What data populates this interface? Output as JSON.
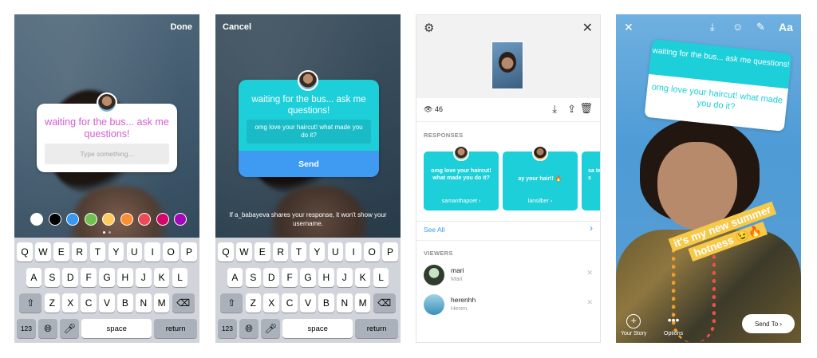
{
  "screen1": {
    "done_label": "Done",
    "question": "waiting for the bus... ask me questions!",
    "placeholder": "Type something...",
    "swatches": [
      "#ffffff",
      "#000000",
      "#3897f0",
      "#70c050",
      "#fdcb5c",
      "#fd8d32",
      "#ed4956",
      "#d10869",
      "#a307ba"
    ]
  },
  "screen2": {
    "cancel_label": "Cancel",
    "question": "waiting for the bus... ask me questions!",
    "answer": "omg love your haircut! what made you do it?",
    "send_label": "Send",
    "note": "If a_babayeva shares your response, it won't show your username."
  },
  "keyboard": {
    "row1": [
      "Q",
      "W",
      "E",
      "R",
      "T",
      "Y",
      "U",
      "I",
      "O",
      "P"
    ],
    "row2": [
      "A",
      "S",
      "D",
      "F",
      "G",
      "H",
      "J",
      "K",
      "L"
    ],
    "row3": [
      "Z",
      "X",
      "C",
      "V",
      "B",
      "N",
      "M"
    ],
    "num_label": "123",
    "space_label": "space",
    "return_label": "return"
  },
  "screen3": {
    "view_count": "46",
    "responses_header": "RESPONSES",
    "responses": [
      {
        "text": "omg love your haircut! what made you do it?",
        "user": "samanthapoet"
      },
      {
        "text": "ay your hair!! 🔥",
        "user": "lansilber"
      },
      {
        "text": "sa te s",
        "user": ""
      }
    ],
    "see_all": "See All",
    "viewers_header": "VIEWERS",
    "viewers": [
      {
        "name": "mari",
        "sub": "Mari"
      },
      {
        "name": "herenhh",
        "sub": "Heren."
      }
    ]
  },
  "screen4": {
    "question": "waiting for the bus... ask me questions!",
    "answer": "omg love your haircut! what made you do it?",
    "caption": "it's my new summer hotness 😉🔥",
    "your_story": "Your Story",
    "options": "Options",
    "send_to": "Send To",
    "text_tool": "Aa"
  },
  "colors": {
    "teal": "#1ccfd8",
    "blue": "#3e9bf1",
    "pink_text": "#d45bd0",
    "caption_yellow": "#f7c948"
  }
}
